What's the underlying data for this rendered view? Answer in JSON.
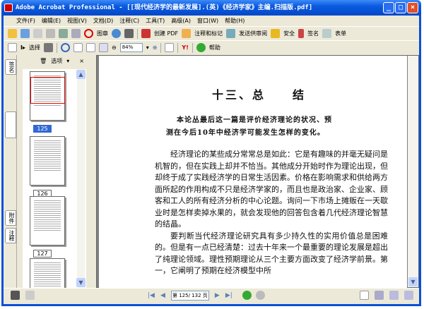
{
  "window": {
    "title": "Adobe Acrobat Professional - [[现代经济学的最新发展].(英)《经济学家》主编.扫描版.pdf]",
    "min": "_",
    "max": "□",
    "close": "×"
  },
  "menu": [
    "文件(F)",
    "编辑(E)",
    "视图(V)",
    "文档(D)",
    "注释(C)",
    "工具(T)",
    "高级(A)",
    "窗口(W)",
    "帮助(H)"
  ],
  "toolbar1": {
    "stamp": "图章",
    "create_pdf": "创建 PDF",
    "comment": "注释和标记",
    "review": "发送供审阅",
    "security": "安全",
    "sign": "签名",
    "forms": "表单"
  },
  "toolbar2": {
    "select": "选择",
    "zoom": "84%",
    "help": "帮助"
  },
  "sidetabs": [
    "签名",
    "附件",
    "注释"
  ],
  "panel": {
    "options": "选项",
    "close": "×",
    "thumbs": [
      {
        "label": "125",
        "selected": true
      },
      {
        "label": "126"
      },
      {
        "label": "127"
      }
    ]
  },
  "page": {
    "title": "十三、总　　结",
    "abstract": [
      "本论丛最后这一篇是评价经济理论的状况、预",
      "测在今后10年中经济学可能发生怎样的变化。"
    ],
    "paragraphs": [
      "经济理论的某些成分常常总是如此：它是有趣味的并毫无疑问是机智的，但在实践上却并不恰当。其他成分开始时作为理论出现，但却终于成了实践经济学的日常生活因素。价格在影响需求和供给两方面所起的作用构成不只是经济学家的，而且也是政治家、企业家、顾客和工人的所有经济分析的中心论题。询问一下市场上摊贩在一天歇业时是怎样卖掉水果的，就会发现他的回答包含着几代经济理论智慧的结晶。",
      "要判断当代经济理论研究具有多少持久性的实用价值总是困难的。但是有一点已经清楚：过去十年来一个最重要的理论发展是超出了纯理论领域。理性预期理论从三个主要方面改变了经济学前景。第一，它阐明了预期在经济模型中所"
    ]
  },
  "status": {
    "page": "第 125/ 132 页"
  }
}
